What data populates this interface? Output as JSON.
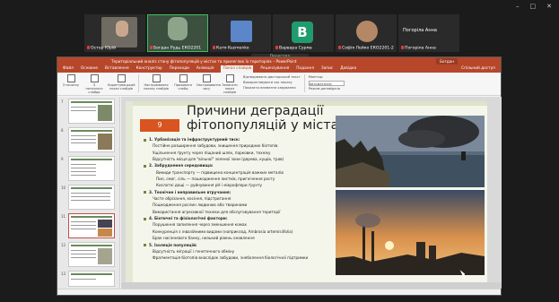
{
  "window_controls": {
    "minimize": "–",
    "maximize": "□",
    "close": "✕"
  },
  "participants": [
    {
      "name": "Остер Юрій",
      "muted": true
    },
    {
      "name": "Богдан Рудь ЕКО2201",
      "muted": true,
      "speaking": true
    },
    {
      "name": "Катя Kuzmenko",
      "muted": true
    },
    {
      "name": "Варвара Сурма",
      "muted": true,
      "initial": "В"
    },
    {
      "name": "Софія Лейко ЕКО2201-2",
      "muted": true
    },
    {
      "name": "Погоріла Анна",
      "muted": true
    }
  ],
  "tile_top_text": "Погоріла Анна",
  "share_bar": "Перегляд",
  "ppt": {
    "window_title": "Територіальний аналіз стану фітопопуляцій у містах та прилеглих їх територіях – PowerPoint",
    "account": "Богдан",
    "tabs": [
      "Файл",
      "Основне",
      "Вставлення",
      "Конструктор",
      "Переходи",
      "Анімація",
      "Показ слайдів",
      "Рецензування",
      "Подання",
      "Запис",
      "Довідка"
    ],
    "selected_tab": "Показ слайдів",
    "share_btn": "Спільний доступ",
    "ribbon": {
      "from_start": "З початку",
      "from_current": "З поточного слайда",
      "custom": "Користувацький показ слайдів",
      "setup": "Настроювання показу слайдів",
      "hide": "Приховати слайд",
      "rehearse": "Настроювання часу",
      "record": "Записати показ слайдів",
      "opt1": "Відтворювати дикторський текст",
      "opt2": "Використовувати час показу",
      "opt3": "Показати елементи керування",
      "monitor_label": "Монітор:",
      "monitor_value": "Автоматично",
      "presenter": "Режим доповідача"
    }
  },
  "thumb_numbers": [
    "7",
    "8",
    "9",
    "10",
    "11",
    "12",
    "13"
  ],
  "slide": {
    "number": "9",
    "title": "Причини деградації фітопопуляцій у містах",
    "lines": [
      {
        "t": "1. Урбанізація та інфраструктурний тиск:",
        "cls": "b"
      },
      {
        "t": "Постійне розширення забудови, знищення природних біотопів",
        "cls": "i1"
      },
      {
        "t": "Ущільнення ґрунту через піщаний шлях, парковки, техніку",
        "cls": "i1"
      },
      {
        "t": "Відсутність місця для \"вільної\" зеленої зони (дерева, кущів, трав)",
        "cls": "i1"
      },
      {
        "t": "2. Забруднення середовища:",
        "cls": "b"
      },
      {
        "t": "Викиди транспорту — підвищена концентрація важких металів",
        "cls": "i2"
      },
      {
        "t": "Пил, смог, сіль — пошкодження листків, пригнічення росту",
        "cls": "i2"
      },
      {
        "t": "Кислотні дощі — руйнування рН і мікрофлори ґрунту",
        "cls": "i2"
      },
      {
        "t": "3. Технічне і неправильне втручання:",
        "cls": "b"
      },
      {
        "t": "Часте обрізання, косіння, підстригання",
        "cls": "i1"
      },
      {
        "t": "Пошкодження рослин людиною або тваринами",
        "cls": "i1"
      },
      {
        "t": "Використання агресивної техніки для обслуговування території",
        "cls": "i1"
      },
      {
        "t": "4. Біотичні та фізіологічні фактори:",
        "cls": "b"
      },
      {
        "t": "Порушення запилення через зменшення комах",
        "cls": "i1"
      },
      {
        "t": "Конкуренція з інвазійними видами (наприклад, Ambrosia artemisiifolia)",
        "cls": "i1"
      },
      {
        "t": "Брак насіннєвого банку, низький рівень оновлення",
        "cls": "i1"
      },
      {
        "t": "5. Ізоляція популяцій:",
        "cls": "b"
      },
      {
        "t": "Відсутність міграції і генетичного обміну",
        "cls": "i1"
      },
      {
        "t": "Фрагментація біотопів внаслідок забудови, знеболення біологічної підтримки",
        "cls": "i1"
      }
    ]
  }
}
